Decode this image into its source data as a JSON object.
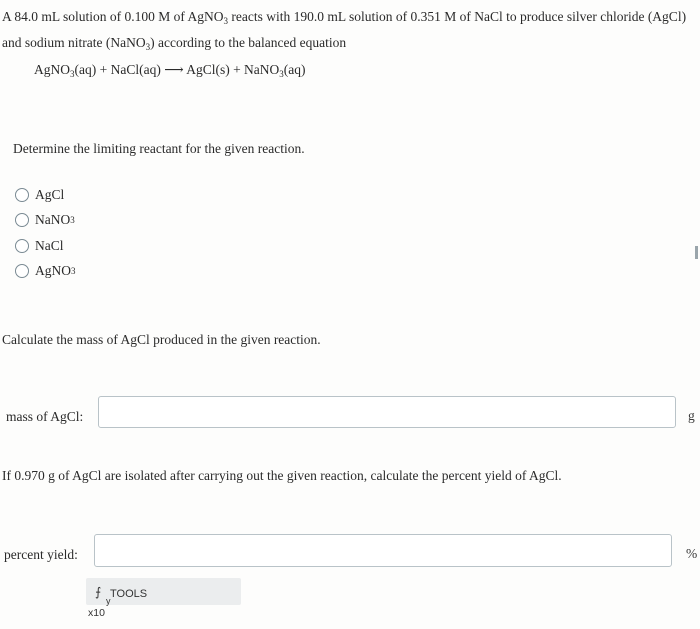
{
  "intro": {
    "line1": "A 84.0 mL solution of 0.100 M of AgNO",
    "line1_sub": "3",
    "line1_rest": " reacts with 190.0 mL solution of 0.351 M of NaCl to produce silver chloride (AgCl)",
    "line2_a": "and sodium nitrate (NaNO",
    "line2_sub": "3",
    "line2_b": ") according to the balanced equation"
  },
  "equation": {
    "p1": "AgNO",
    "p1_sub": "3",
    "p2": "(aq) + NaCl(aq) ",
    "arrow": "⟶",
    "p3": " AgCl(s) + NaNO",
    "p3_sub": "3",
    "p4": "(aq)"
  },
  "question_limiting": "Determine the limiting reactant for the given reaction.",
  "options": [
    {
      "label": "AgCl",
      "sub": ""
    },
    {
      "label": "NaNO",
      "sub": "3"
    },
    {
      "label": "NaCl",
      "sub": ""
    },
    {
      "label": "AgNO",
      "sub": "3"
    }
  ],
  "question_mass": "Calculate the mass of AgCl produced in the given reaction.",
  "mass_field": {
    "label": "mass of AgCl:",
    "value": "",
    "unit": "g"
  },
  "question_yield": "If 0.970 g of AgCl are isolated after carrying out the given reaction, calculate the percent yield of AgCl.",
  "yield_field": {
    "label": "percent yield:",
    "value": "",
    "unit": "%"
  },
  "tools": {
    "label": "TOOLS",
    "icon": "⨍",
    "sub": "y",
    "multiplier": "x10"
  }
}
